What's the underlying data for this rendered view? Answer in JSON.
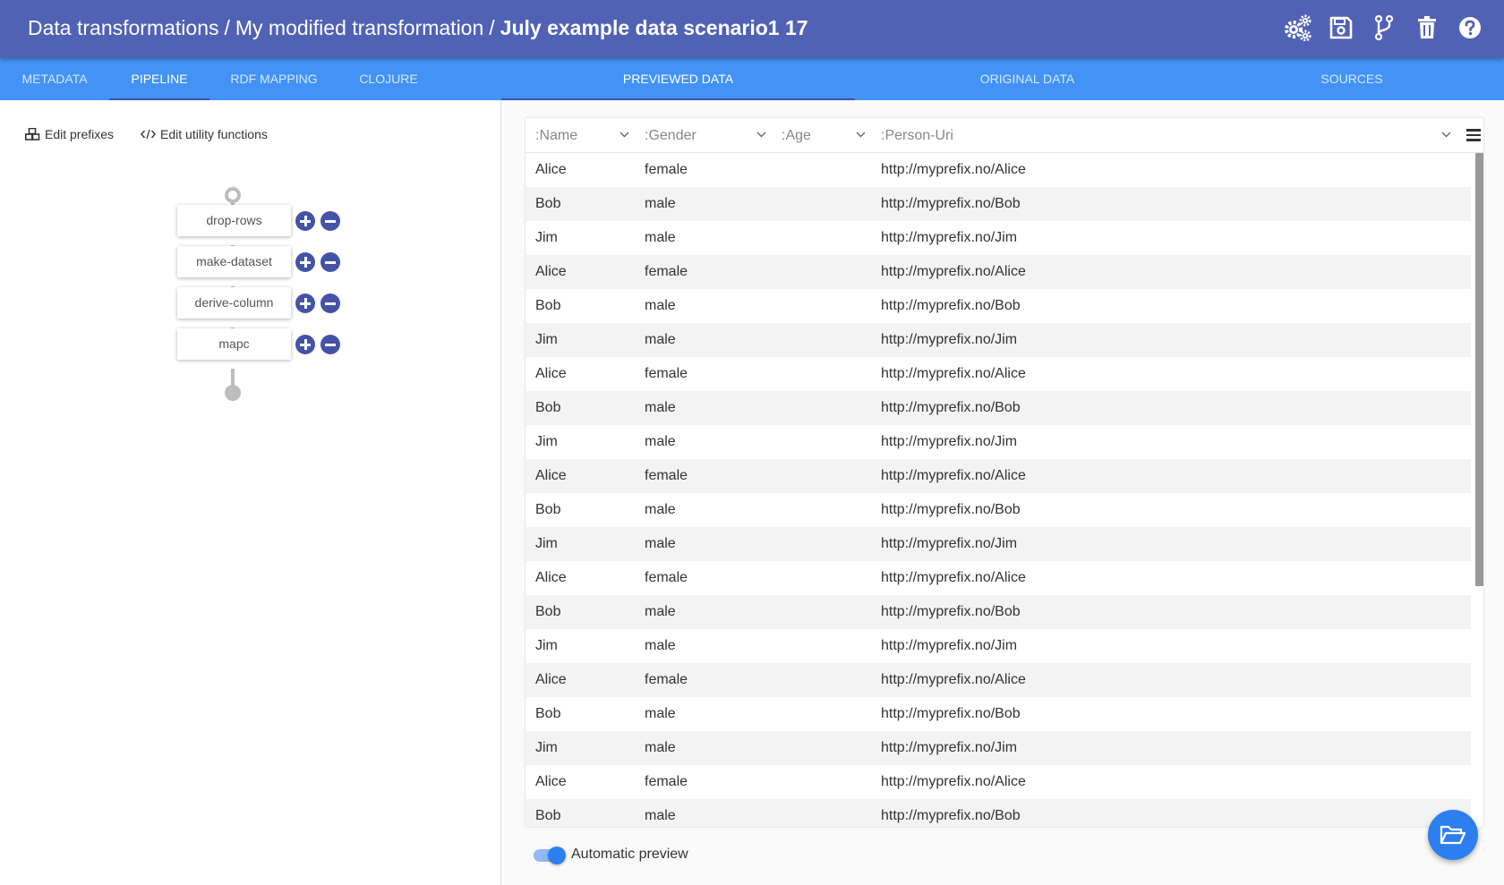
{
  "header": {
    "crumbs": [
      "Data transformations",
      "My modified transformation",
      "July example data scenario1 17"
    ],
    "separator": "/",
    "actions": [
      {
        "name": "settings-gears-icon"
      },
      {
        "name": "save-icon"
      },
      {
        "name": "fork-icon"
      },
      {
        "name": "trash-icon"
      },
      {
        "name": "help-icon"
      }
    ]
  },
  "left_tabs": [
    "METADATA",
    "PIPELINE",
    "RDF MAPPING",
    "CLOJURE"
  ],
  "right_tabs": [
    "PREVIEWED DATA",
    "ORIGINAL DATA",
    "SOURCES"
  ],
  "active_left_tab": "PIPELINE",
  "active_right_tab": "PREVIEWED DATA",
  "edit_links": {
    "prefixes": "Edit prefixes",
    "utility": "Edit utility functions"
  },
  "pipeline": {
    "steps": [
      "drop-rows",
      "make-dataset",
      "derive-column",
      "mapc"
    ]
  },
  "grid": {
    "columns": [
      ":Name",
      ":Gender",
      ":Age",
      ":Person-Uri"
    ],
    "rows": [
      [
        "Alice",
        "female",
        "",
        "http://myprefix.no/Alice"
      ],
      [
        "Bob",
        "male",
        "",
        "http://myprefix.no/Bob"
      ],
      [
        "Jim",
        "male",
        "",
        "http://myprefix.no/Jim"
      ],
      [
        "Alice",
        "female",
        "",
        "http://myprefix.no/Alice"
      ],
      [
        "Bob",
        "male",
        "",
        "http://myprefix.no/Bob"
      ],
      [
        "Jim",
        "male",
        "",
        "http://myprefix.no/Jim"
      ],
      [
        "Alice",
        "female",
        "",
        "http://myprefix.no/Alice"
      ],
      [
        "Bob",
        "male",
        "",
        "http://myprefix.no/Bob"
      ],
      [
        "Jim",
        "male",
        "",
        "http://myprefix.no/Jim"
      ],
      [
        "Alice",
        "female",
        "",
        "http://myprefix.no/Alice"
      ],
      [
        "Bob",
        "male",
        "",
        "http://myprefix.no/Bob"
      ],
      [
        "Jim",
        "male",
        "",
        "http://myprefix.no/Jim"
      ],
      [
        "Alice",
        "female",
        "",
        "http://myprefix.no/Alice"
      ],
      [
        "Bob",
        "male",
        "",
        "http://myprefix.no/Bob"
      ],
      [
        "Jim",
        "male",
        "",
        "http://myprefix.no/Jim"
      ],
      [
        "Alice",
        "female",
        "",
        "http://myprefix.no/Alice"
      ],
      [
        "Bob",
        "male",
        "",
        "http://myprefix.no/Bob"
      ],
      [
        "Jim",
        "male",
        "",
        "http://myprefix.no/Jim"
      ],
      [
        "Alice",
        "female",
        "",
        "http://myprefix.no/Alice"
      ],
      [
        "Bob",
        "male",
        "",
        "http://myprefix.no/Bob"
      ]
    ]
  },
  "automatic_preview": {
    "label": "Automatic preview",
    "enabled": true
  },
  "fab": {
    "icon": "folder-open-icon"
  },
  "colors": {
    "header": "#5162b5",
    "tabbar": "#4393f7",
    "accent": "#2d7ff0",
    "step_button": "#4452a8"
  }
}
